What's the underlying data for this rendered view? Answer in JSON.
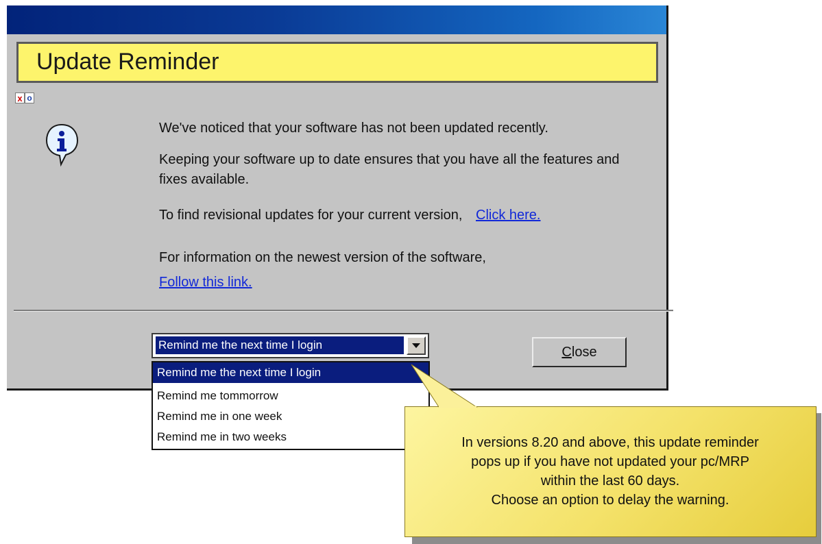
{
  "dialog": {
    "title": "Update Reminder",
    "mini_buttons": {
      "x": "x",
      "o": "o"
    },
    "icon": "info-bubble-icon",
    "message_1": "We've noticed that your software has not been updated recently.",
    "message_2": "Keeping your software up to date ensures that you have all the features and fixes available.",
    "message_3": "To find revisional updates for your current version,",
    "message_3_link": "Click here.",
    "message_4": "For information on the newest version of the software,",
    "message_4_link": "Follow this link.",
    "reminder_select": {
      "selected": "Remind me the next time I login",
      "options": [
        "Remind me the next time I login",
        "Remind me tommorrow",
        "Remind me in one week",
        "Remind me in two weeks"
      ]
    },
    "close_button": "Close"
  },
  "callout": {
    "lines": [
      "In versions 8.20 and above, this update reminder",
      "pops up if you have not updated your pc/MRP",
      "within the last 60 days.",
      "Choose an option to delay the warning."
    ]
  },
  "colors": {
    "banner": "#fdf46c",
    "title_bar_start": "#02237a",
    "title_bar_end": "#2a86d6",
    "selection": "#0a1d7e",
    "link": "#1128d8",
    "callout": "#f4e26a"
  }
}
